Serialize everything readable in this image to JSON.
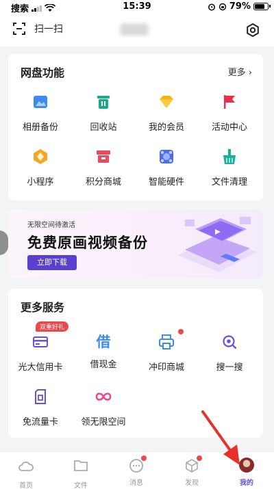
{
  "status_bar": {
    "carrier": "搜索",
    "time": "15:39",
    "battery": "79%",
    "battery_level": 0.79
  },
  "header": {
    "scan_label": "扫一扫"
  },
  "netdisk": {
    "title": "网盘功能",
    "more": "更多 ›",
    "items": [
      {
        "label": "相册备份",
        "icon": "photo-backup-icon",
        "color": "#3b8bf0"
      },
      {
        "label": "回收站",
        "icon": "recycle-bin-icon",
        "color": "#1aa98a"
      },
      {
        "label": "我的会员",
        "icon": "diamond-icon",
        "color": "#f5b400"
      },
      {
        "label": "活动中心",
        "icon": "flag-icon",
        "color": "#e8304a"
      },
      {
        "label": "小程序",
        "icon": "mini-program-icon",
        "color": "#f5a623"
      },
      {
        "label": "积分商城",
        "icon": "store-icon",
        "color": "#e84a5f"
      },
      {
        "label": "智能硬件",
        "icon": "hardware-icon",
        "color": "#4a6cf5"
      },
      {
        "label": "文件清理",
        "icon": "broom-icon",
        "color": "#19b09a"
      }
    ]
  },
  "banner": {
    "subtitle": "无限空间待激活",
    "title": "免费原画视频备份",
    "button": "立即下载"
  },
  "services": {
    "title": "更多服务",
    "badge": "双重好礼",
    "items": [
      {
        "label": "光大信用卡",
        "icon": "credit-card-icon",
        "color": "#6a4fd9"
      },
      {
        "label": "借现金",
        "icon": "borrow-cash-icon",
        "color": "#3b8bf0"
      },
      {
        "label": "冲印商城",
        "icon": "printer-icon",
        "color": "#3b8bf0"
      },
      {
        "label": "搜一搜",
        "icon": "search-icon",
        "color": "#6a4fd9"
      },
      {
        "label": "免流量卡",
        "icon": "sim-card-icon",
        "color": "#6a4fd9"
      },
      {
        "label": "领无限空间",
        "icon": "infinity-icon",
        "color": "#e84a8a"
      }
    ],
    "borrow_glyph": "借"
  },
  "tabbar": {
    "tabs": [
      {
        "label": "首页",
        "icon": "cloud-icon"
      },
      {
        "label": "文件",
        "icon": "folder-icon"
      },
      {
        "label": "消息",
        "icon": "message-icon"
      },
      {
        "label": "发现",
        "icon": "cube-icon"
      },
      {
        "label": "我的",
        "icon": "avatar"
      }
    ]
  },
  "colors": {
    "accent": "#6a4fd9",
    "red": "#e84a4a"
  }
}
